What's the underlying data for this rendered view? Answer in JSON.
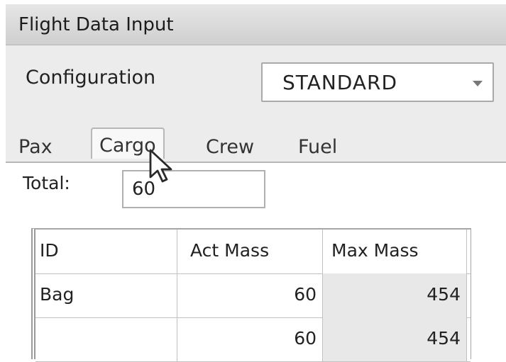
{
  "window": {
    "title": "Flight Data Input"
  },
  "configuration": {
    "label": "Configuration",
    "selected": "STANDARD"
  },
  "tabs": [
    {
      "label": "Pax",
      "active": false
    },
    {
      "label": "Cargo",
      "active": true
    },
    {
      "label": "Crew",
      "active": false
    },
    {
      "label": "Fuel",
      "active": false
    }
  ],
  "cargo": {
    "total_label": "Total:",
    "total_value": "60",
    "columns": [
      "ID",
      "Act Mass",
      "Max Mass"
    ],
    "rows": [
      {
        "id": "Bag",
        "act_mass": "60",
        "max_mass": "454"
      },
      {
        "id": "",
        "act_mass": "60",
        "max_mass": "454"
      }
    ]
  },
  "icons": {
    "dropdown": "chevron-down-icon",
    "cursor": "mouse-pointer-icon"
  },
  "colors": {
    "titlebar": "#d6d6d6",
    "panel_bg": "#ececec",
    "readonly_cell": "#e8e8e8"
  }
}
